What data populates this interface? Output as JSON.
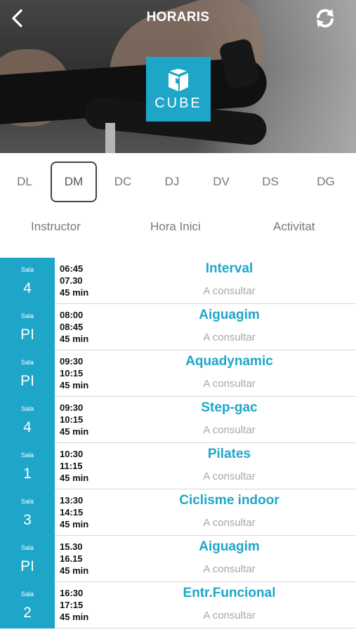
{
  "header": {
    "title": "HORARIS",
    "logo_text": "CUBE",
    "accent_color": "#1ea6c9",
    "back_icon": "chevron-left-icon",
    "refresh_icon": "refresh-icon"
  },
  "days": [
    {
      "label": "DL",
      "active": false
    },
    {
      "label": "DM",
      "active": true
    },
    {
      "label": "DC",
      "active": false
    },
    {
      "label": "DJ",
      "active": false
    },
    {
      "label": "DV",
      "active": false
    },
    {
      "label": "DS",
      "active": false
    },
    {
      "label": "DG",
      "active": false
    }
  ],
  "columns": {
    "instructor": "Instructor",
    "start": "Hora Inici",
    "activity": "Activitat"
  },
  "classes": [
    {
      "sala_label": "Sala",
      "sala": "4",
      "start": "06:45",
      "end": "07.30",
      "duration": "45 min",
      "activity": "Interval",
      "instructor": "A consultar"
    },
    {
      "sala_label": "Sala",
      "sala": "PI",
      "start": "08:00",
      "end": "08:45",
      "duration": "45 min",
      "activity": "Aiguagim",
      "instructor": "A consultar"
    },
    {
      "sala_label": "Sala",
      "sala": "PI",
      "start": "09:30",
      "end": "10:15",
      "duration": "45 min",
      "activity": "Aquadynamic",
      "instructor": "A consultar"
    },
    {
      "sala_label": "Sala",
      "sala": "4",
      "start": "09:30",
      "end": "10:15",
      "duration": "45 min",
      "activity": "Step-gac",
      "instructor": "A consultar"
    },
    {
      "sala_label": "Sala",
      "sala": "1",
      "start": "10:30",
      "end": "11:15",
      "duration": "45 min",
      "activity": "Pilates",
      "instructor": "A consultar"
    },
    {
      "sala_label": "Sala",
      "sala": "3",
      "start": "13:30",
      "end": "14:15",
      "duration": "45 min",
      "activity": "Ciclisme indoor",
      "instructor": "A consultar"
    },
    {
      "sala_label": "Sala",
      "sala": "PI",
      "start": "15.30",
      "end": "16.15",
      "duration": "45 min",
      "activity": "Aiguagim",
      "instructor": "A consultar"
    },
    {
      "sala_label": "Sala",
      "sala": "2",
      "start": "16:30",
      "end": "17:15",
      "duration": "45 min",
      "activity": "Entr.Funcional",
      "instructor": "A consultar"
    }
  ]
}
